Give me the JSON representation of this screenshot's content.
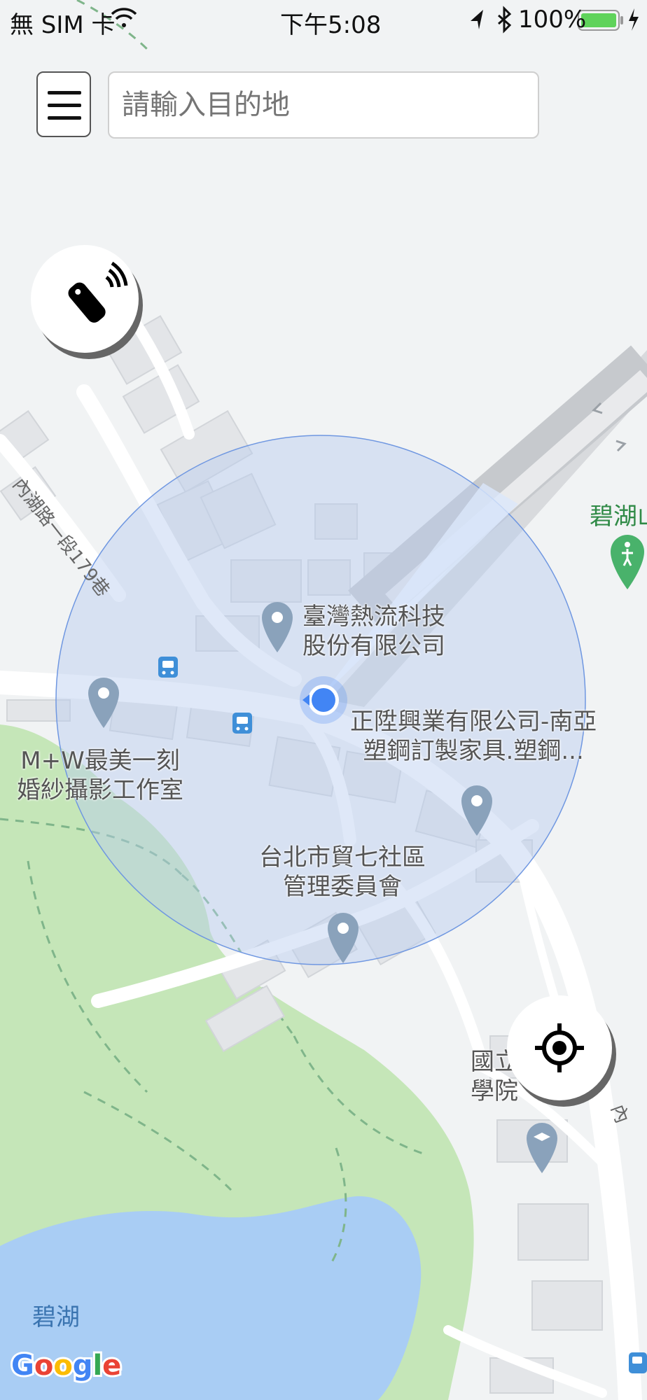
{
  "status_bar": {
    "carrier": "無 SIM 卡",
    "time": "下午5:08",
    "battery": "100%",
    "icons": [
      "wifi-icon",
      "location-arrow-icon",
      "bluetooth-icon",
      "battery-icon",
      "charging-icon"
    ]
  },
  "search": {
    "placeholder": "請輸入目的地",
    "value": ""
  },
  "menu": {
    "icon": "hamburger-menu-icon"
  },
  "remote_button": {
    "icon": "remote-control-icon"
  },
  "locate_button": {
    "icon": "crosshair-icon"
  },
  "map": {
    "labels": {
      "poi_tecnetwork": "臺灣熱流科技\n股份有限公司",
      "poi_zhenglu": "正陞興業有限公司-南亞\n塑鋼訂製家具.塑鋼...",
      "poi_mw": "M+W最美一刻\n婚紗攝影工作室",
      "poi_community": "台北市貿七社區\n管理委員會",
      "poi_school": "國立\n學院",
      "road_neihu": "內湖路一段179巷",
      "park_bihu_mountain": "碧湖山",
      "lake_bihu": "碧湖",
      "road_edge": "內"
    },
    "attribution": "Google",
    "colors": {
      "background": "#f1f3f4",
      "park": "#c5e6b8",
      "water": "#a9cdf4",
      "accuracy_circle": "#b9cdef",
      "user_dot": "#4285f4",
      "poi_pin": "#8aa2bb"
    }
  }
}
